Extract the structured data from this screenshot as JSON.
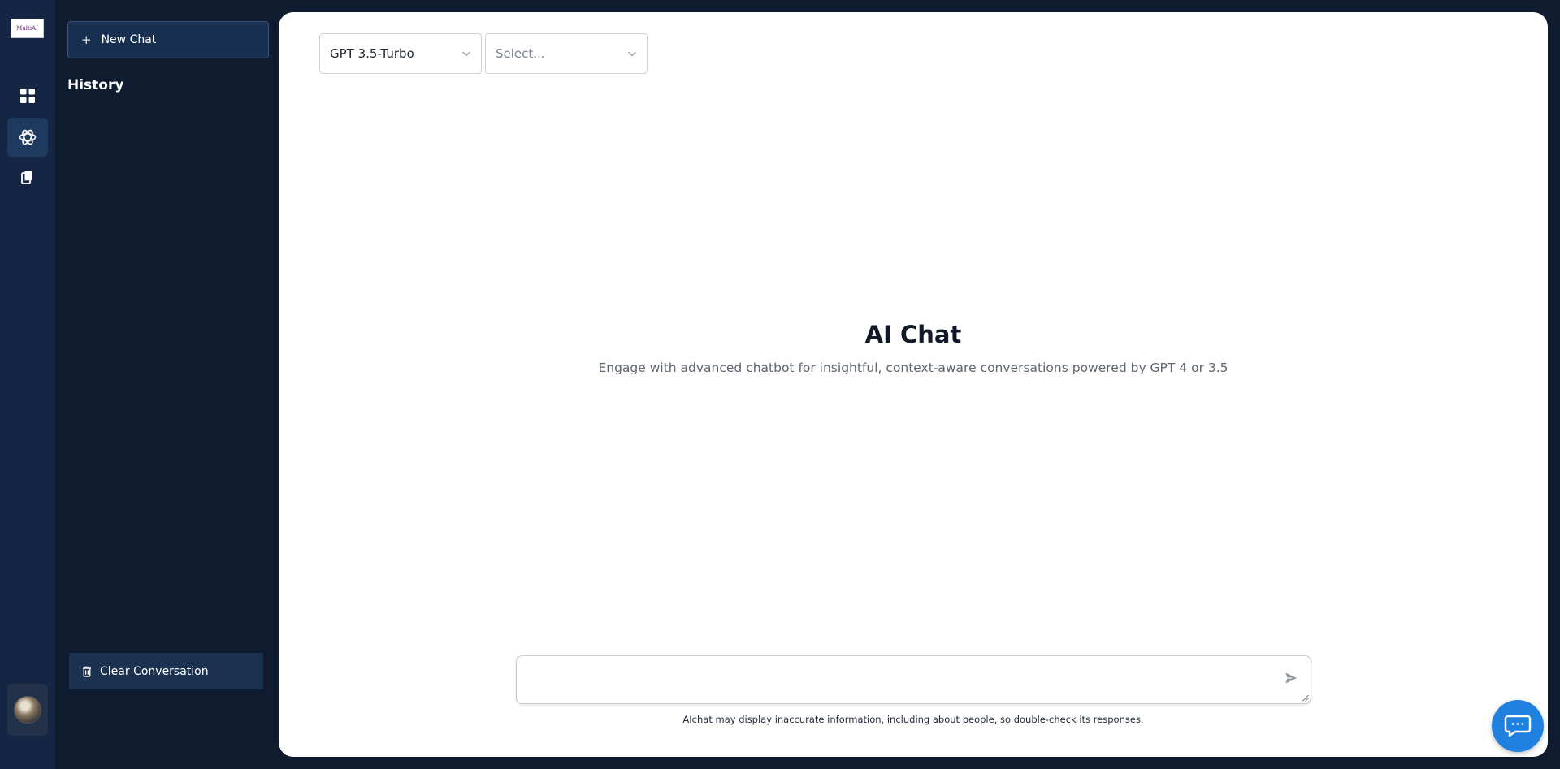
{
  "rail": {
    "logo_text": "MultiAI",
    "nav": [
      {
        "icon": "dashboard-grid-icon"
      },
      {
        "icon": "openai-chat-icon",
        "active": true
      },
      {
        "icon": "documents-icon"
      }
    ],
    "avatar_icon": "user-avatar"
  },
  "sidebar": {
    "new_chat_label": "New Chat",
    "history_title": "History",
    "clear_label": "Clear Conversation"
  },
  "main": {
    "model_select": {
      "value": "GPT 3.5-Turbo"
    },
    "option_select": {
      "placeholder": "Select..."
    },
    "title": "AI Chat",
    "subtitle": "Engage with advanced chatbot for insightful, context-aware conversations powered by GPT 4 or 3.5",
    "chat_input": {
      "value": ""
    },
    "disclaimer": "AIchat may display inaccurate information, including about people, so double-check its responses."
  },
  "colors": {
    "rail_bg": "#142643",
    "sidebar_bg": "#0f1b2f",
    "accent_blue": "#1f80e0",
    "main_bg": "#ffffff"
  }
}
